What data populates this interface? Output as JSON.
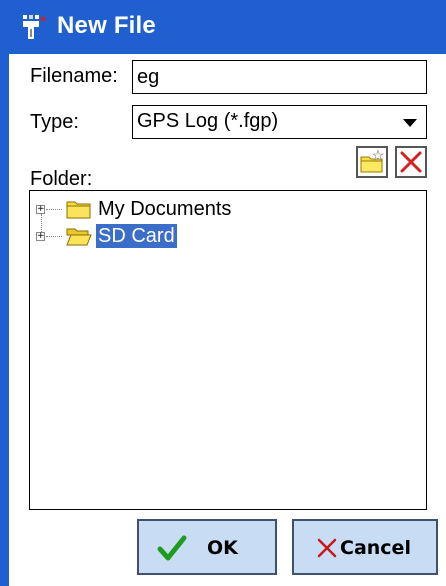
{
  "window": {
    "title": "New File",
    "title_icon": "gps-file-icon"
  },
  "form": {
    "filename_label": "Filename:",
    "filename_value": "eg",
    "type_label": "Type:",
    "type_selected": "GPS Log (*.fgp)",
    "folder_label": "Folder:"
  },
  "toolbar": {
    "new_folder_icon": "new-folder-icon",
    "delete_icon": "delete-icon"
  },
  "tree": {
    "nodes": [
      {
        "label": "My Documents",
        "selected": false,
        "icon": "folder-icon"
      },
      {
        "label": "SD Card",
        "selected": true,
        "icon": "open-folder-icon"
      }
    ]
  },
  "buttons": {
    "ok_label": "OK",
    "cancel_label": "Cancel"
  },
  "colors": {
    "titlebar": "#1f5fd0",
    "selection": "#3a6ec8",
    "button_face": "#c8dcf4"
  }
}
